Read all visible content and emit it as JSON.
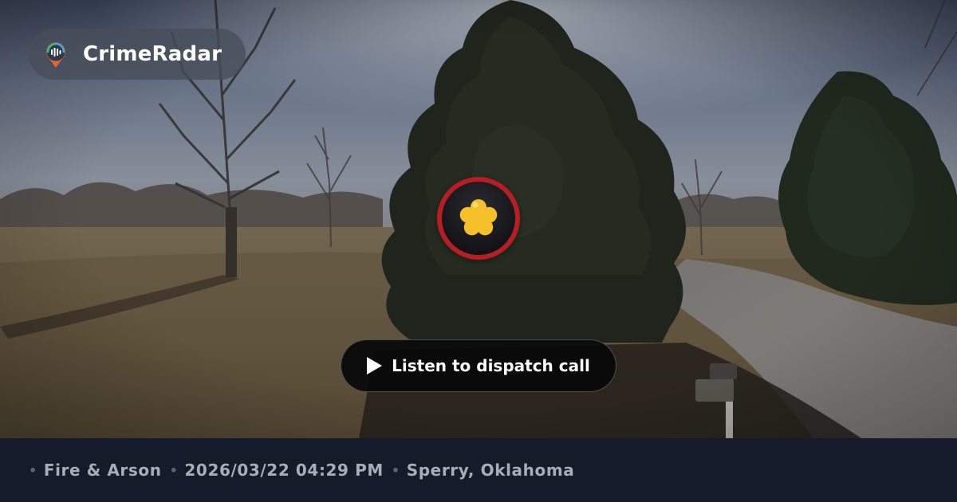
{
  "brand": {
    "name": "CrimeRadar",
    "icon": "radio-pin-icon"
  },
  "marker": {
    "icon": "fire-flower-icon",
    "ring_color": "#b51f24",
    "icon_color": "#f5c02a"
  },
  "action": {
    "listen_label": "Listen to dispatch call",
    "icon": "play-icon"
  },
  "incident": {
    "category": "Fire & Arson",
    "datetime": "2026/03/22 04:29 PM",
    "location": "Sperry, Oklahoma"
  }
}
